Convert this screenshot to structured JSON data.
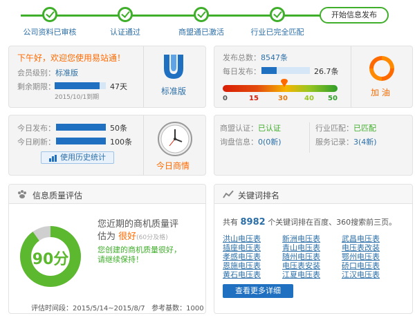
{
  "steps": [
    {
      "label": "公司资料已审核"
    },
    {
      "label": "认证通过"
    },
    {
      "label": "商盟通已激活"
    },
    {
      "label": "行业已完全匹配"
    }
  ],
  "final_step": {
    "label": "开始信息发布"
  },
  "account": {
    "greeting": "下午好，欢迎您使用易站通！",
    "level_label": "会员级别：",
    "level_value": "标准版",
    "remaining_label": "剩余期限：",
    "remaining_value": "47天",
    "remaining_fraction": 0.88,
    "expiry_note": "2015/10/1到期",
    "badge_label": "标准版"
  },
  "publish": {
    "total_label": "发布总数：",
    "total_value": "8547条",
    "daily_label": "每日发布：",
    "daily_value": "26.7条",
    "daily_fraction": 0.32,
    "scale_ticks": [
      "0",
      "15",
      "30",
      "40",
      "50"
    ],
    "scale_marker_value": 26.7,
    "boost_label": "加 油"
  },
  "today": {
    "publish_label": "今日发布：",
    "publish_value": "50条",
    "refresh_label": "今日刷新：",
    "refresh_value": "100条",
    "history_button": "使用历史统计",
    "clock_label": "今日商情"
  },
  "status": {
    "alliance_label": "商盟认证：",
    "alliance_value": "已认证",
    "industry_label": "行业匹配：",
    "industry_value": "已匹配",
    "inquiry_label": "询盘信息：",
    "inquiry_value": "0(0新)",
    "service_label": "服务记录：",
    "service_value": "3(4新)"
  },
  "quality": {
    "title": "信息质量评估",
    "score": "90分",
    "score_fraction": 0.9,
    "desc_line1": "您近期的商机质量评",
    "desc_line2_prefix": "估为",
    "desc_rating": "很好",
    "desc_threshold": "(60分及格)",
    "encourage_line1": "您创建的商机质量很好，",
    "encourage_line2": "请继续保持！",
    "footer_time": "评估时间段：2015/5/14~2015/8/7",
    "footer_base": "参考基数：1000"
  },
  "keywords": {
    "title": "关键词排名",
    "summary_prefix": "共有",
    "summary_count": "8982",
    "summary_suffix": "个关键词排在百度、360搜索前三页。",
    "col1": [
      "洪山电压表",
      "插座电压表",
      "孝感电压表",
      "恩施电压表",
      "黄石电压表"
    ],
    "col2": [
      "新洲电压表",
      "青山电压表",
      "随州电压表",
      "电压表安装",
      "江夏电压表"
    ],
    "col3": [
      "武昌电压表",
      "电压表改装",
      "鄂州电压表",
      "硚口电压表",
      "江汉电压表"
    ],
    "more_button": "查看更多详细"
  },
  "colors": {
    "green": "#3fae2a",
    "blue": "#1f70c1",
    "orange": "#ff6a00"
  }
}
